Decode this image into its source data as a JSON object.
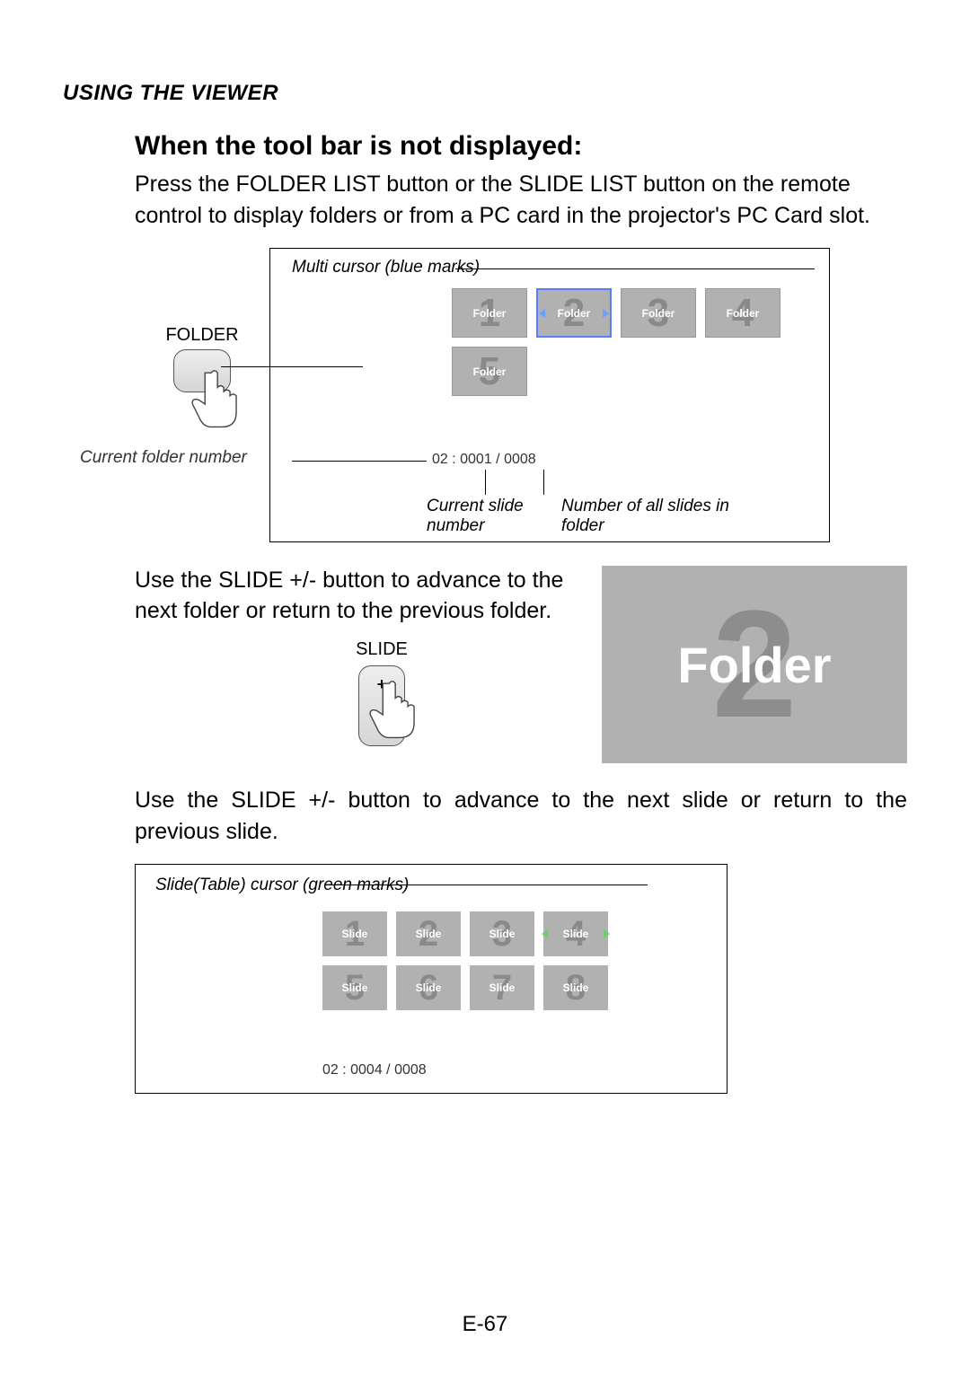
{
  "header": {
    "section": "USING THE VIEWER"
  },
  "heading": "When the tool bar is not displayed:",
  "body1": "Press the FOLDER LIST button or the SLIDE LIST button on the remote control to display folders or from a PC card in the projector's PC Card slot.",
  "diagram1": {
    "button_label": "FOLDER",
    "multi_cursor": "Multi cursor (blue marks)",
    "current_folder_label": "Current folder number",
    "current_slide_label": "Current slide number",
    "num_all_label": "Number of all slides in folder",
    "status": "02 : 0001 / 0008",
    "folder_label": "Folder",
    "nums": [
      "1",
      "2",
      "3",
      "4",
      "5"
    ]
  },
  "body2": "Use the SLIDE +/- button to advance to the next folder or return to the previous folder.",
  "slide_btn": {
    "label": "SLIDE",
    "plus": "+",
    "minus": "–"
  },
  "big_folder": {
    "bg": "2",
    "label": "Folder"
  },
  "body3": "Use the SLIDE +/- button to advance to the next slide or return to the previous slide.",
  "diagram3": {
    "label": "Slide(Table) cursor (green marks)",
    "slide_label": "Slide",
    "nums": [
      "1",
      "2",
      "3",
      "4",
      "5",
      "6",
      "7",
      "8"
    ],
    "status": "02 : 0004 / 0008"
  },
  "page": "E-67"
}
